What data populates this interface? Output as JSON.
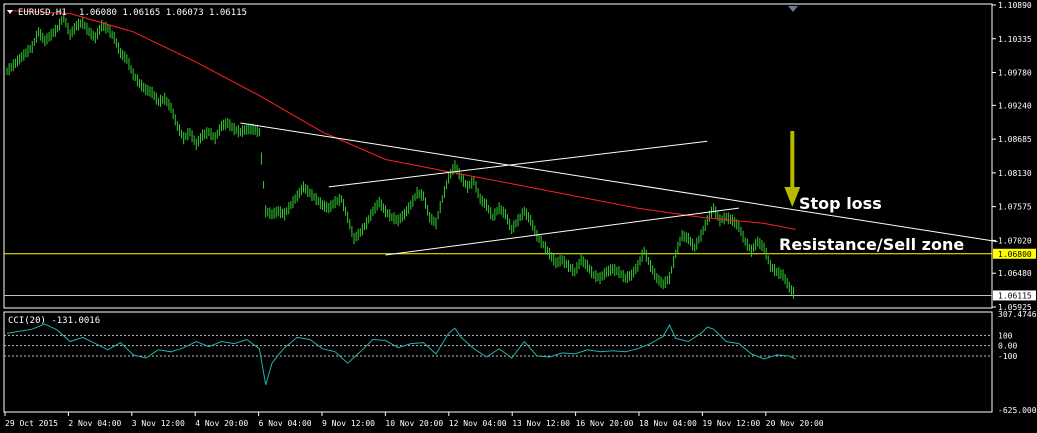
{
  "header": {
    "symbol": "EURUSD,H1",
    "ohlc": "1.06080 1.06165 1.06073 1.06115"
  },
  "indicator": {
    "label": "CCI(20) -131.0016",
    "levels": [
      "307.4746",
      "100",
      "0.00",
      "-100",
      "-625.0000"
    ]
  },
  "annotations": {
    "stop_loss": "Stop loss",
    "resistance": "Resistance/Sell zone"
  },
  "colors": {
    "background": "#000000",
    "candles": "#32cd32",
    "ma": "#ff2020",
    "trendlines": "#ffffff",
    "resistance_line": "#ffff00",
    "cci": "#20b2aa",
    "arrow": "#b8b800",
    "axis": "#ffffff"
  },
  "chart_data": {
    "type": "line",
    "price_axis_ticks": [
      "1.10890",
      "1.10335",
      "1.09780",
      "1.09240",
      "1.08685",
      "1.08130",
      "1.07575",
      "1.07020",
      "1.06480",
      "1.05925"
    ],
    "price_range": [
      1.0592,
      1.1089
    ],
    "resistance_level": "1.06800",
    "current_price": "1.06115",
    "time_axis_ticks": [
      "29 Oct 2015",
      "2 Nov 04:00",
      "3 Nov 12:00",
      "4 Nov 20:00",
      "6 Nov 04:00",
      "9 Nov 12:00",
      "10 Nov 20:00",
      "12 Nov 04:00",
      "13 Nov 12:00",
      "16 Nov 20:00",
      "18 Nov 04:00",
      "19 Nov 12:00",
      "20 Nov 20:00"
    ],
    "series": [
      {
        "name": "EURUSD,H1",
        "points": [
          [
            0,
            1.098
          ],
          [
            3,
            1.099
          ],
          [
            6,
            1.1
          ],
          [
            9,
            1.101
          ],
          [
            12,
            1.102
          ],
          [
            15,
            1.1045
          ],
          [
            18,
            1.103
          ],
          [
            21,
            1.104
          ],
          [
            24,
            1.105
          ],
          [
            27,
            1.107
          ],
          [
            30,
            1.104
          ],
          [
            33,
            1.1055
          ],
          [
            36,
            1.106
          ],
          [
            39,
            1.1045
          ],
          [
            42,
            1.1035
          ],
          [
            45,
            1.1055
          ],
          [
            48,
            1.105
          ],
          [
            51,
            1.1035
          ],
          [
            54,
            1.101
          ],
          [
            57,
            1.1
          ],
          [
            60,
            1.0975
          ],
          [
            63,
            1.096
          ],
          [
            66,
            1.095
          ],
          [
            69,
            1.0945
          ],
          [
            72,
            1.093
          ],
          [
            75,
            1.0935
          ],
          [
            78,
            1.092
          ],
          [
            81,
            1.089
          ],
          [
            84,
            1.087
          ],
          [
            87,
            1.088
          ],
          [
            90,
            1.086
          ],
          [
            93,
            1.0875
          ],
          [
            96,
            1.088
          ],
          [
            99,
            1.087
          ],
          [
            102,
            1.089
          ],
          [
            105,
            1.0895
          ],
          [
            108,
            1.0885
          ],
          [
            111,
            1.088
          ],
          [
            114,
            1.0885
          ],
          [
            117,
            1.0885
          ],
          [
            120,
            1.088
          ],
          [
            123,
            1.075
          ],
          [
            126,
            1.0745
          ],
          [
            129,
            1.075
          ],
          [
            132,
            1.0745
          ],
          [
            135,
            1.076
          ],
          [
            138,
            1.0775
          ],
          [
            141,
            1.079
          ],
          [
            144,
            1.078
          ],
          [
            147,
            1.077
          ],
          [
            150,
            1.076
          ],
          [
            153,
            1.0755
          ],
          [
            156,
            1.0765
          ],
          [
            159,
            1.077
          ],
          [
            162,
            1.074
          ],
          [
            165,
            1.0705
          ],
          [
            168,
            1.0715
          ],
          [
            171,
            1.073
          ],
          [
            174,
            1.075
          ],
          [
            177,
            1.0765
          ],
          [
            180,
            1.075
          ],
          [
            183,
            1.074
          ],
          [
            186,
            1.0735
          ],
          [
            189,
            1.0745
          ],
          [
            192,
            1.076
          ],
          [
            195,
            1.078
          ],
          [
            198,
            1.0775
          ],
          [
            201,
            1.074
          ],
          [
            204,
            1.073
          ],
          [
            207,
            1.077
          ],
          [
            210,
            1.0805
          ],
          [
            213,
            1.0825
          ],
          [
            216,
            1.0805
          ],
          [
            219,
            1.079
          ],
          [
            222,
            1.08
          ],
          [
            225,
            1.077
          ],
          [
            228,
            1.076
          ],
          [
            231,
            1.074
          ],
          [
            234,
            1.0755
          ],
          [
            237,
            1.0745
          ],
          [
            240,
            1.072
          ],
          [
            243,
            1.0735
          ],
          [
            246,
            1.075
          ],
          [
            249,
            1.0735
          ],
          [
            252,
            1.071
          ],
          [
            255,
            1.0695
          ],
          [
            258,
            1.068
          ],
          [
            261,
            1.0665
          ],
          [
            264,
            1.067
          ],
          [
            267,
            1.066
          ],
          [
            270,
            1.065
          ],
          [
            273,
            1.067
          ],
          [
            276,
            1.066
          ],
          [
            279,
            1.0645
          ],
          [
            282,
            1.064
          ],
          [
            285,
            1.065
          ],
          [
            288,
            1.0655
          ],
          [
            291,
            1.065
          ],
          [
            294,
            1.064
          ],
          [
            297,
            1.0645
          ],
          [
            300,
            1.066
          ],
          [
            303,
            1.0685
          ],
          [
            306,
            1.066
          ],
          [
            309,
            1.064
          ],
          [
            312,
            1.063
          ],
          [
            315,
            1.064
          ],
          [
            318,
            1.068
          ],
          [
            321,
            1.071
          ],
          [
            324,
            1.0705
          ],
          [
            327,
            1.069
          ],
          [
            330,
            1.071
          ],
          [
            333,
            1.0735
          ],
          [
            336,
            1.0755
          ],
          [
            339,
            1.0735
          ],
          [
            342,
            1.074
          ],
          [
            345,
            1.0735
          ],
          [
            348,
            1.0725
          ],
          [
            351,
            1.07
          ],
          [
            354,
            1.0685
          ],
          [
            357,
            1.07
          ],
          [
            360,
            1.069
          ],
          [
            363,
            1.066
          ],
          [
            366,
            1.065
          ],
          [
            369,
            1.0645
          ],
          [
            372,
            1.0625
          ],
          [
            375,
            1.0611
          ]
        ]
      },
      {
        "name": "MA",
        "points": [
          [
            0,
            1.108
          ],
          [
            30,
            1.1075
          ],
          [
            60,
            1.1045
          ],
          [
            90,
            1.0995
          ],
          [
            120,
            1.094
          ],
          [
            150,
            1.088
          ],
          [
            180,
            1.0835
          ],
          [
            210,
            1.0815
          ],
          [
            240,
            1.0795
          ],
          [
            270,
            1.0775
          ],
          [
            300,
            1.0755
          ],
          [
            330,
            1.074
          ],
          [
            360,
            1.073
          ],
          [
            375,
            1.072
          ]
        ]
      },
      {
        "name": "CCI(20)",
        "points": [
          [
            0,
            120
          ],
          [
            6,
            140
          ],
          [
            12,
            160
          ],
          [
            18,
            210
          ],
          [
            24,
            150
          ],
          [
            30,
            40
          ],
          [
            36,
            80
          ],
          [
            42,
            20
          ],
          [
            48,
            -40
          ],
          [
            54,
            30
          ],
          [
            60,
            -90
          ],
          [
            66,
            -120
          ],
          [
            72,
            -40
          ],
          [
            78,
            -60
          ],
          [
            84,
            -20
          ],
          [
            90,
            40
          ],
          [
            96,
            -10
          ],
          [
            102,
            40
          ],
          [
            108,
            20
          ],
          [
            114,
            60
          ],
          [
            120,
            -30
          ],
          [
            123,
            -380
          ],
          [
            126,
            -170
          ],
          [
            129,
            -90
          ],
          [
            132,
            -20
          ],
          [
            138,
            80
          ],
          [
            144,
            60
          ],
          [
            150,
            -30
          ],
          [
            156,
            -60
          ],
          [
            162,
            -170
          ],
          [
            168,
            -60
          ],
          [
            174,
            60
          ],
          [
            180,
            50
          ],
          [
            186,
            -20
          ],
          [
            192,
            20
          ],
          [
            198,
            30
          ],
          [
            204,
            -80
          ],
          [
            210,
            120
          ],
          [
            213,
            170
          ],
          [
            216,
            80
          ],
          [
            222,
            -30
          ],
          [
            228,
            -110
          ],
          [
            234,
            -30
          ],
          [
            240,
            -120
          ],
          [
            246,
            40
          ],
          [
            252,
            -100
          ],
          [
            258,
            -110
          ],
          [
            264,
            -70
          ],
          [
            270,
            -80
          ],
          [
            276,
            -40
          ],
          [
            282,
            -60
          ],
          [
            288,
            -50
          ],
          [
            294,
            -60
          ],
          [
            300,
            -30
          ],
          [
            306,
            20
          ],
          [
            312,
            90
          ],
          [
            315,
            200
          ],
          [
            318,
            70
          ],
          [
            324,
            40
          ],
          [
            330,
            120
          ],
          [
            333,
            180
          ],
          [
            336,
            160
          ],
          [
            342,
            40
          ],
          [
            348,
            20
          ],
          [
            354,
            -80
          ],
          [
            360,
            -130
          ],
          [
            366,
            -90
          ],
          [
            372,
            -100
          ],
          [
            375,
            -131
          ]
        ]
      }
    ],
    "trendlines": [
      {
        "from": [
          111,
          1.0895
        ],
        "to": [
          471,
          1.07
        ]
      },
      {
        "from": [
          153,
          1.079
        ],
        "to": [
          333,
          1.0865
        ]
      },
      {
        "from": [
          180,
          1.0678
        ],
        "to": [
          348,
          1.0755
        ]
      }
    ],
    "grid": false
  }
}
